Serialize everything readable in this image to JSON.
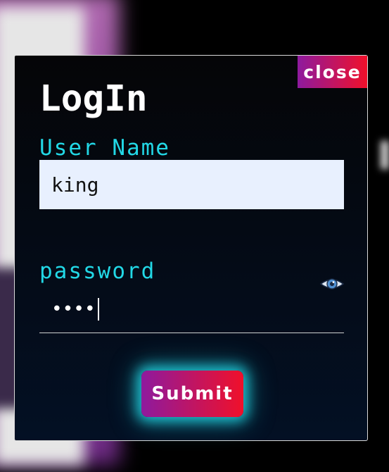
{
  "dialog": {
    "close_label": "close",
    "title": "LogIn",
    "username": {
      "label": "User Name",
      "value": "king"
    },
    "password": {
      "label": "password",
      "masked_value": "••••",
      "toggle_icon": "eye-icon"
    },
    "submit_label": "Submit"
  },
  "colors": {
    "label_cyan": "#22d8e6",
    "gradient_start": "#8e1a9e",
    "gradient_end": "#f0102a",
    "input_background": "#e8f0fe",
    "dialog_background": "#031024"
  }
}
